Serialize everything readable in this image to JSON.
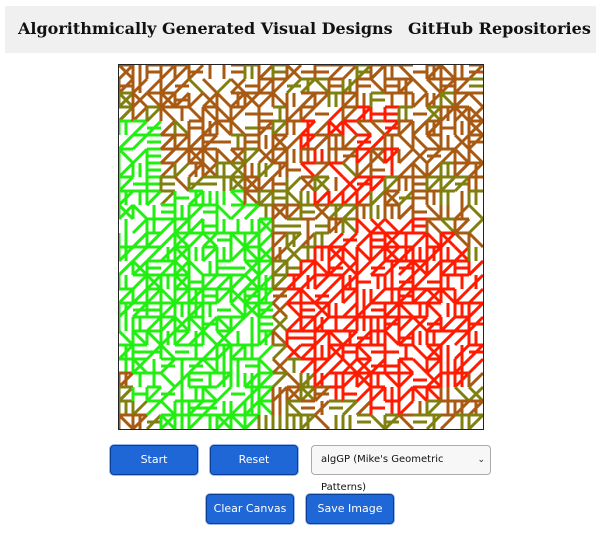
{
  "header": {
    "designs_link": "Algorithmically Generated Visual Designs",
    "github_link": "GitHub Repositories"
  },
  "canvas": {
    "description_icon": "geometric-pattern-canvas",
    "colors": {
      "green": "#22ee11",
      "olive": "#7f8010",
      "brown": "#a85a12",
      "red": "#ff1a00"
    }
  },
  "controls": {
    "start_label": "Start",
    "reset_label": "Reset",
    "algorithm_select": {
      "selected": "algGP (Mike's Geometric Patterns)"
    },
    "clear_label": "Clear Canvas",
    "save_label": "Save Image"
  },
  "theme": {
    "button_blue": "#1f66d6",
    "topbar_bg": "#f0f0f0"
  }
}
